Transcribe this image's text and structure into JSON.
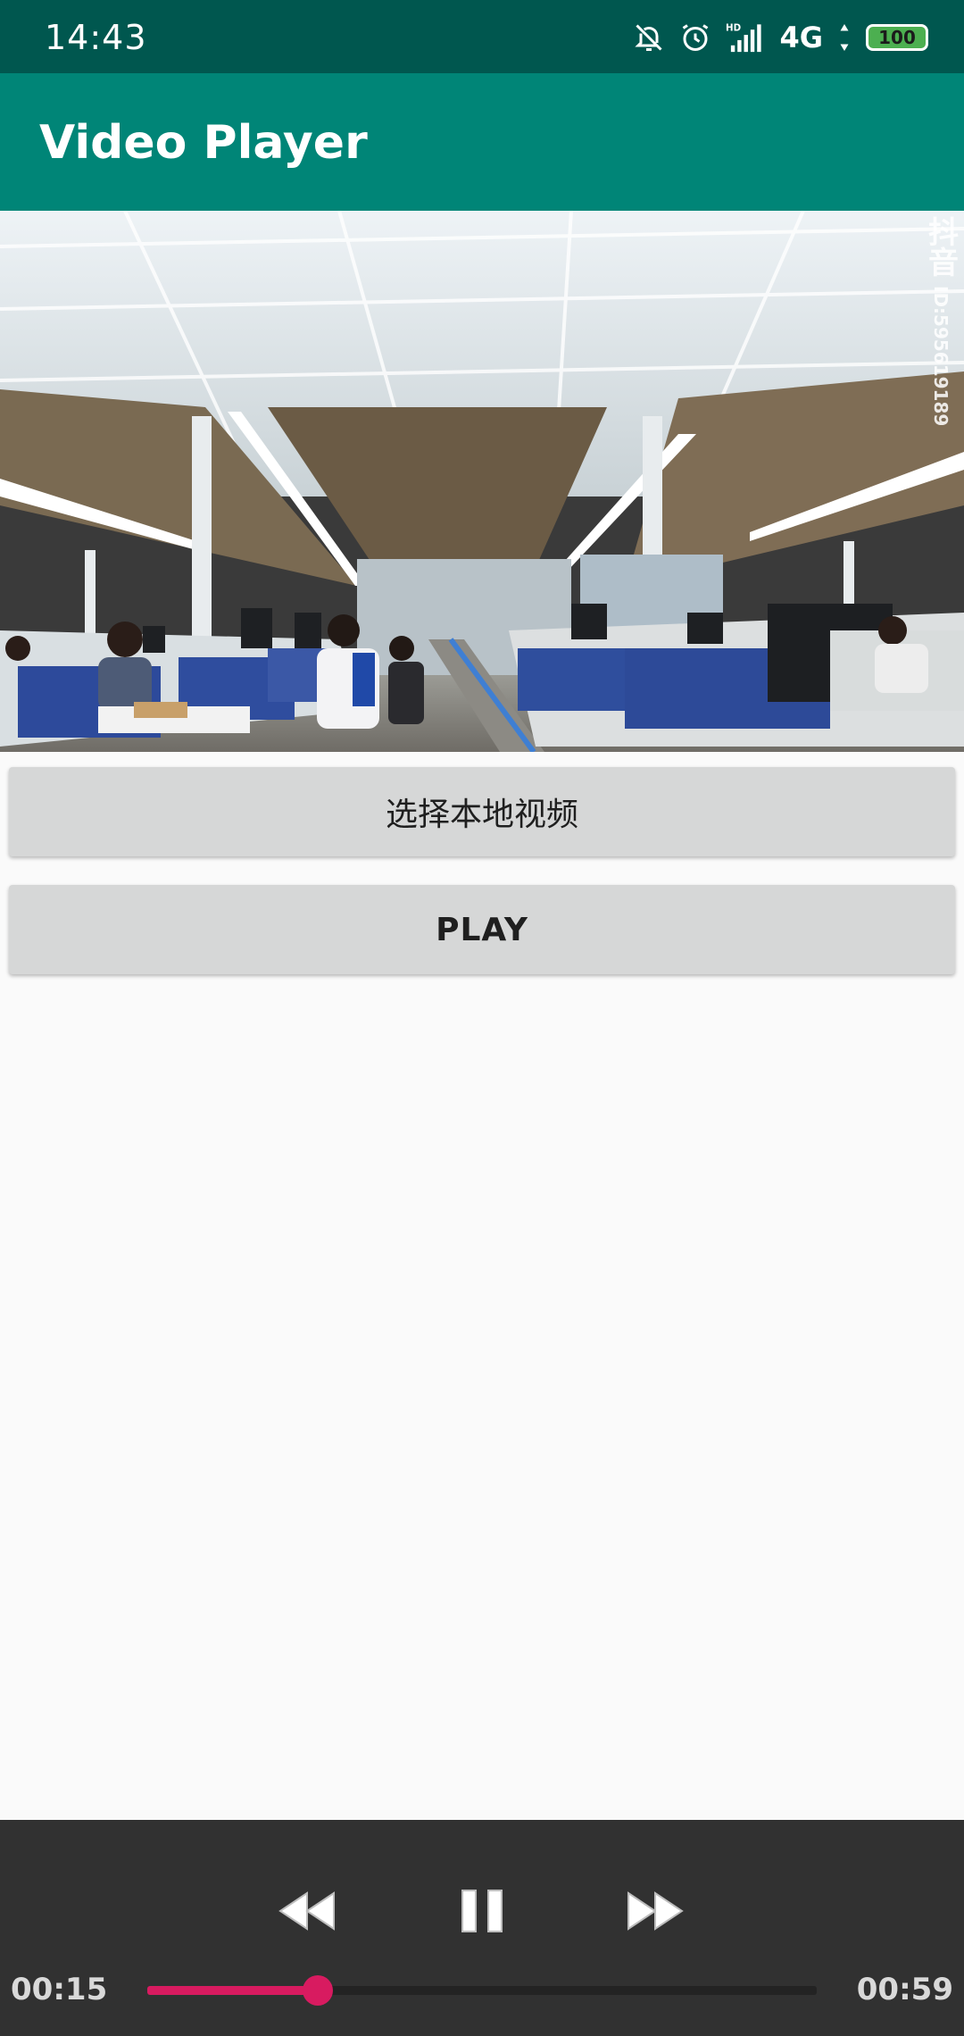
{
  "status_bar": {
    "time": "14:43",
    "network": "4G",
    "battery": "100"
  },
  "app_bar": {
    "title": "Video Player"
  },
  "video": {
    "watermark_logo": "抖音",
    "watermark_id": "ID:595619189"
  },
  "buttons": {
    "select_local_video": "选择本地视频",
    "play": "PLAY"
  },
  "media_controller": {
    "current_time": "00:15",
    "total_time": "00:59",
    "progress": 0.254
  },
  "colors": {
    "status_bar": "#00574f",
    "app_bar": "#008577",
    "accent": "#d81b60",
    "controller_bg": "#313131"
  }
}
